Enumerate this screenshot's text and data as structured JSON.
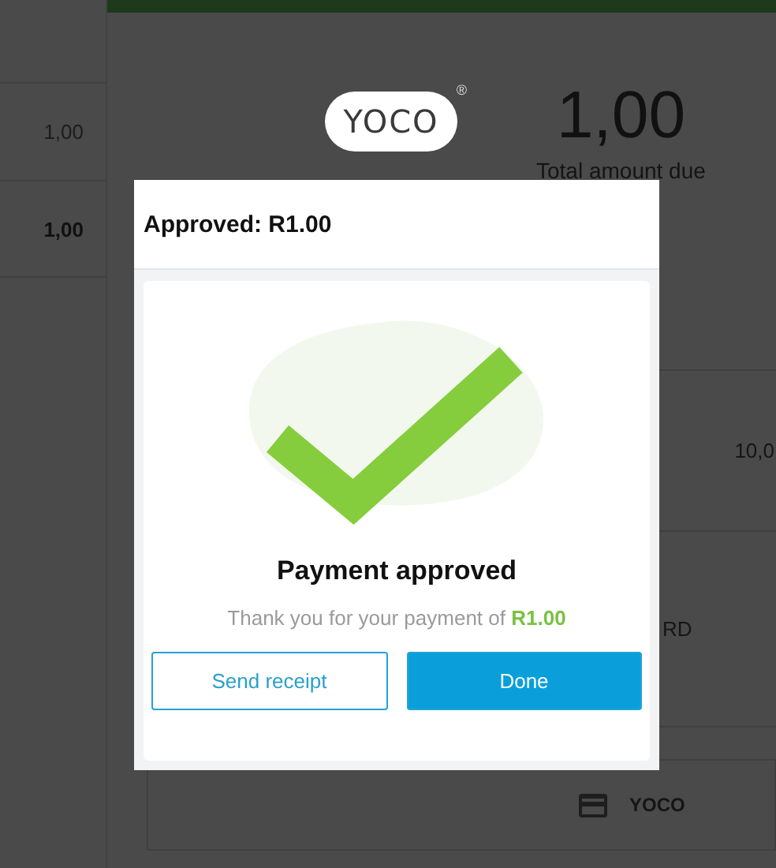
{
  "left_rows": [
    {
      "amount": "1,00",
      "selected": false
    },
    {
      "amount": "1,00",
      "selected": true
    }
  ],
  "header": {
    "logo": "YOCO",
    "registered": "®",
    "amount": "1,00",
    "caption": "Total amount due"
  },
  "right_rows": [
    "10,0",
    "RD"
  ],
  "payment_method": {
    "label": "YOCO"
  },
  "dialog": {
    "title": "Approved: R1.00",
    "heading": "Payment approved",
    "message": "Thank you for your payment of **R1.00**",
    "buttons": [
      {
        "label": "Send receipt",
        "kind": "outline"
      },
      {
        "label": "Done",
        "kind": "primary"
      }
    ]
  }
}
